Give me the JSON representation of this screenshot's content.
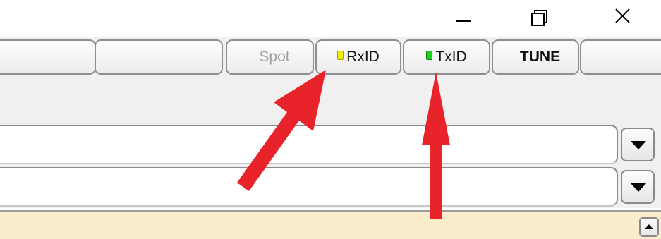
{
  "window_controls": {
    "minimize_icon": "minimize-icon",
    "restore_icon": "restore-icon",
    "close_icon": "close-icon"
  },
  "toolbar": {
    "buttons": [
      {
        "label": "",
        "state": "normal"
      },
      {
        "label": "",
        "state": "normal"
      },
      {
        "label": "Spot",
        "state": "disabled",
        "indicator": "off"
      },
      {
        "label": "RxID",
        "state": "normal",
        "indicator": "on",
        "indicator_color": "#f2ee00"
      },
      {
        "label": "TxID",
        "state": "normal",
        "indicator": "on",
        "indicator_color": "#1fd11f"
      },
      {
        "label": "TUNE",
        "state": "normal",
        "indicator": "off"
      },
      {
        "label": "",
        "state": "normal"
      }
    ]
  },
  "combos": [
    {
      "value": "",
      "dropdown_icon": "chevron-down-icon"
    },
    {
      "value": "",
      "dropdown_icon": "chevron-down-icon"
    }
  ],
  "notes_area": {
    "value": "",
    "background_color": "#fbeccb",
    "scroll_icon": "chevron-up-icon"
  },
  "annotations": {
    "arrow_color": "#e8232a"
  }
}
